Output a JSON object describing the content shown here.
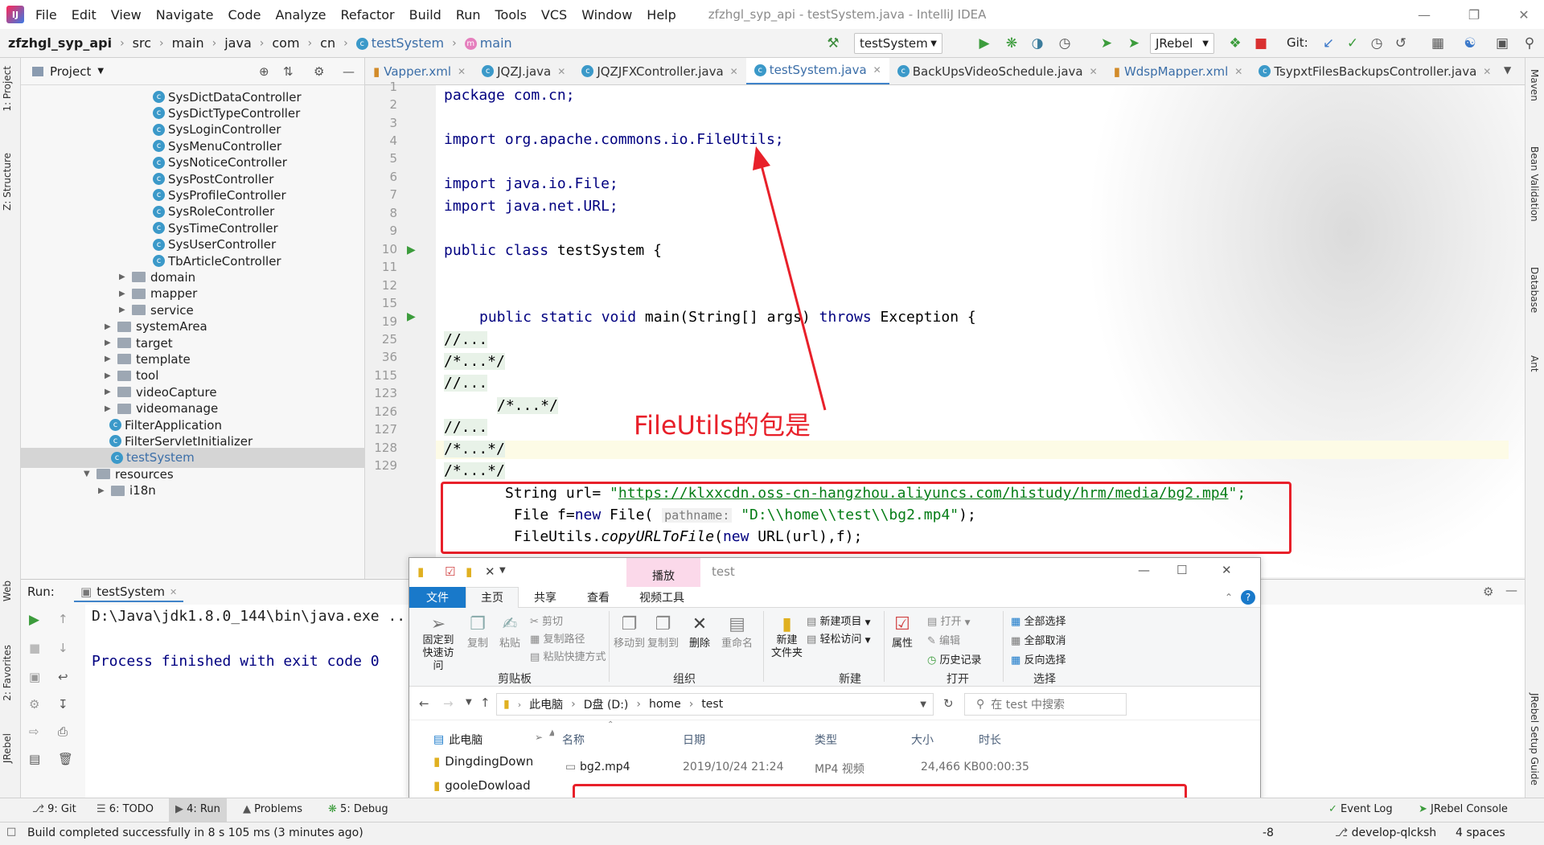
{
  "menu": {
    "items": [
      "File",
      "Edit",
      "View",
      "Navigate",
      "Code",
      "Analyze",
      "Refactor",
      "Build",
      "Run",
      "Tools",
      "VCS",
      "Window",
      "Help"
    ],
    "window_title": "zfzhgl_syp_api - testSystem.java - IntelliJ IDEA"
  },
  "breadcrumb": {
    "project": "zfzhgl_syp_api",
    "parts": [
      "src",
      "main",
      "java",
      "com",
      "cn"
    ],
    "file": "testSystem",
    "method": "main"
  },
  "toolbar": {
    "run_config": "testSystem",
    "jrebel": "JRebel",
    "git_label": "Git:"
  },
  "project_panel": {
    "title": "Project",
    "tree": [
      {
        "label": "SysDictDataController",
        "kind": "class"
      },
      {
        "label": "SysDictTypeController",
        "kind": "class"
      },
      {
        "label": "SysLoginController",
        "kind": "class"
      },
      {
        "label": "SysMenuController",
        "kind": "class"
      },
      {
        "label": "SysNoticeController",
        "kind": "class"
      },
      {
        "label": "SysPostController",
        "kind": "class"
      },
      {
        "label": "SysProfileController",
        "kind": "class"
      },
      {
        "label": "SysRoleController",
        "kind": "class"
      },
      {
        "label": "SysTimeController",
        "kind": "class"
      },
      {
        "label": "SysUserController",
        "kind": "class"
      },
      {
        "label": "TbArticleController",
        "kind": "class"
      },
      {
        "label": "domain",
        "kind": "folder"
      },
      {
        "label": "mapper",
        "kind": "folder"
      },
      {
        "label": "service",
        "kind": "folder"
      },
      {
        "label": "systemArea",
        "kind": "folder"
      },
      {
        "label": "target",
        "kind": "folder"
      },
      {
        "label": "template",
        "kind": "folder"
      },
      {
        "label": "tool",
        "kind": "folder"
      },
      {
        "label": "videoCapture",
        "kind": "folder"
      },
      {
        "label": "videomanage",
        "kind": "folder"
      },
      {
        "label": "FilterApplication",
        "kind": "class"
      },
      {
        "label": "FilterServletInitializer",
        "kind": "class"
      },
      {
        "label": "testSystem",
        "kind": "class"
      },
      {
        "label": "resources",
        "kind": "folder"
      },
      {
        "label": "i18n",
        "kind": "folder"
      }
    ]
  },
  "editor_tabs": [
    "Vapper.xml",
    "JQZJ.java",
    "JQZJFXController.java",
    "testSystem.java",
    "BackUpsVideoSchedule.java",
    "WdspMapper.xml",
    "TsypxtFilesBackupsController.java"
  ],
  "code": {
    "line_numbers": [
      "1",
      "2",
      "3",
      "4",
      "5",
      "6",
      "7",
      "8",
      "9",
      "10",
      "11",
      "12",
      "15",
      "19",
      "25",
      "36",
      "115",
      "123",
      "126",
      "127",
      "128",
      "129"
    ],
    "l1": "package com.cn;",
    "l3": "import org.apache.commons.io.FileUtils;",
    "l5": "import java.io.File;",
    "l6": "import java.net.URL;",
    "l8a": "public class",
    "l8b": " testSystem {",
    "l11a": "public static void",
    "l11b": " main(String[] args) ",
    "l11c": "throws",
    "l11d": " Exception {",
    "f12": "//...",
    "f15": "/*...*/",
    "f19": "//...",
    "f25": "/*...*/",
    "f36": "//...",
    "f115": "/*...*/",
    "f123": "/*...*/",
    "l126a": "String url= ",
    "l126q1": "\"",
    "l126url": "https://klxxcdn.oss-cn-hangzhou.aliyuncs.com/histudy/hrm/media/bg2.mp4",
    "l126q2": "\";",
    "l127a": " File f=",
    "l127new": "new",
    "l127b": " File( ",
    "l127hint": "pathname:",
    "l127str": " \"D:\\\\home\\\\test\\\\bg2.mp4\"",
    "l127c": ");",
    "l128a": " FileUtils.",
    "l128m": "copyURLToFile",
    "l128b": "(",
    "l128new": "new",
    "l128c": " URL(url),f);"
  },
  "annotation": "FileUtils的包是",
  "run_panel": {
    "label": "Run:",
    "tab": "testSystem",
    "cmd": "D:\\Java\\jdk1.8.0_144\\bin\\java.exe ...",
    "exit": "Process finished with exit code 0"
  },
  "explorer": {
    "title": "test",
    "play_tab": "播放",
    "ribbon_tabs": [
      "文件",
      "主页",
      "共享",
      "查看",
      "视频工具"
    ],
    "clipboard": {
      "pin": "固定到\n快速访问",
      "copy": "复制",
      "paste": "粘贴",
      "cut": "剪切",
      "copy_path": "复制路径",
      "paste_shortcut": "粘贴快捷方式",
      "group": "剪贴板"
    },
    "organize": {
      "move": "移动到",
      "copyto": "复制到",
      "delete": "删除",
      "rename": "重命名",
      "group": "组织"
    },
    "new": {
      "folder": "新建\n文件夹",
      "item": "新建项目",
      "easy": "轻松访问",
      "group": "新建"
    },
    "open": {
      "props": "属性",
      "open": "打开",
      "edit": "编辑",
      "history": "历史记录",
      "group": "打开"
    },
    "select": {
      "all": "全部选择",
      "none": "全部取消",
      "invert": "反向选择",
      "group": "选择"
    },
    "address": [
      "此电脑",
      "D盘 (D:)",
      "home",
      "test"
    ],
    "search_placeholder": "在 test 中搜索",
    "nav": [
      "此电脑",
      "DingdingDown",
      "gooleDowload"
    ],
    "columns": [
      "名称",
      "日期",
      "类型",
      "大小",
      "时长"
    ],
    "file": {
      "name": "bg2.mp4",
      "date": "2019/10/24 21:24",
      "type": "MP4 视频",
      "size": "24,466 KB",
      "duration": "00:00:35"
    }
  },
  "bottom_tabs": {
    "git": "9: Git",
    "todo": "6: TODO",
    "run": "4: Run",
    "problems": "Problems",
    "debug": "5: Debug",
    "eventlog": "Event Log",
    "jrebel_console": "JRebel Console"
  },
  "status": {
    "message": "Build completed successfully in 8 s 105 ms (3 minutes ago)",
    "line_sep": "-8",
    "branch": "develop-qlcksh",
    "indent": "4 spaces"
  },
  "side_tabs": {
    "left": [
      "1: Project",
      "Z: Structure",
      "Web",
      "2: Favorites",
      "JRebel"
    ],
    "right": [
      "Maven",
      "Bean Validation",
      "Database",
      "Ant",
      "JRebel Setup Guide"
    ]
  },
  "colors": {
    "accent": "#4083c9",
    "annotation_red": "#e8202a",
    "keyword": "#000080",
    "string": "#067d17"
  }
}
